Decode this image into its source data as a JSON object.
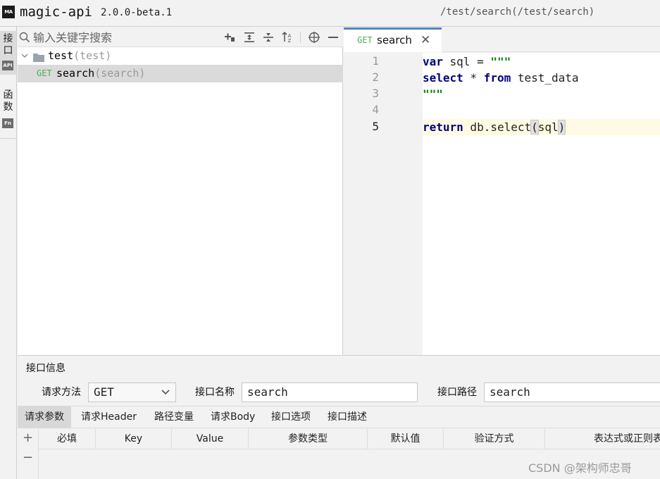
{
  "header": {
    "logo_text": "MA",
    "app_title": "magic-api",
    "version": "2.0.0-beta.1",
    "current_path": "/test/search(/test/search)"
  },
  "side_rail": {
    "tabs": [
      {
        "label": "接\n口",
        "icon": "API",
        "active": true
      },
      {
        "label": "函\n数",
        "icon": "Fn",
        "active": false
      }
    ]
  },
  "explorer": {
    "search_placeholder": "输入关键字搜索",
    "toolbar_icons": [
      "add-icon",
      "expand-all-icon",
      "collapse-all-icon",
      "sort-icon",
      "locate-icon",
      "minimize-icon"
    ],
    "tree": [
      {
        "type": "group",
        "name": "test",
        "path": "(test)",
        "expanded": true
      },
      {
        "type": "api",
        "method": "GET",
        "name": "search",
        "path": "(search)",
        "selected": true
      }
    ]
  },
  "editor": {
    "tab": {
      "method": "GET",
      "label": "search",
      "close": "✕"
    },
    "current_line": 5,
    "lines": [
      {
        "no": "1"
      },
      {
        "no": "2"
      },
      {
        "no": "3"
      },
      {
        "no": "4"
      },
      {
        "no": "5"
      }
    ],
    "code": {
      "l1_kw": "var",
      "l1_rest": " sql = ",
      "l1_str": "\"\"\"",
      "l2_kw1": "select",
      "l2_mid": " * ",
      "l2_kw2": "from",
      "l2_rest": " test_data",
      "l3_str": "\"\"\"",
      "l5_kw": "return",
      "l5_call": " db.select",
      "l5_open": "(",
      "l5_arg": "sql",
      "l5_close": ")"
    }
  },
  "bottom_panel": {
    "title": "接口信息",
    "method_label": "请求方法",
    "method_value": "GET",
    "name_label": "接口名称",
    "name_value": "search",
    "path_label": "接口路径",
    "path_value": "search",
    "tabs": [
      "请求参数",
      "请求Header",
      "路径变量",
      "请求Body",
      "接口选项",
      "接口描述"
    ],
    "active_tab": 0,
    "table_headers": [
      "必填",
      "Key",
      "Value",
      "参数类型",
      "默认值",
      "验证方式",
      "表达式或正则表达式"
    ],
    "add_symbol": "+",
    "remove_symbol": "−"
  },
  "watermark": "CSDN @架构师忠哥",
  "colors": {
    "accent": "#4e86c2",
    "method_get": "#4caf50",
    "keyword": "#000080",
    "string": "#008000",
    "current_line_bg": "#fffae3"
  }
}
